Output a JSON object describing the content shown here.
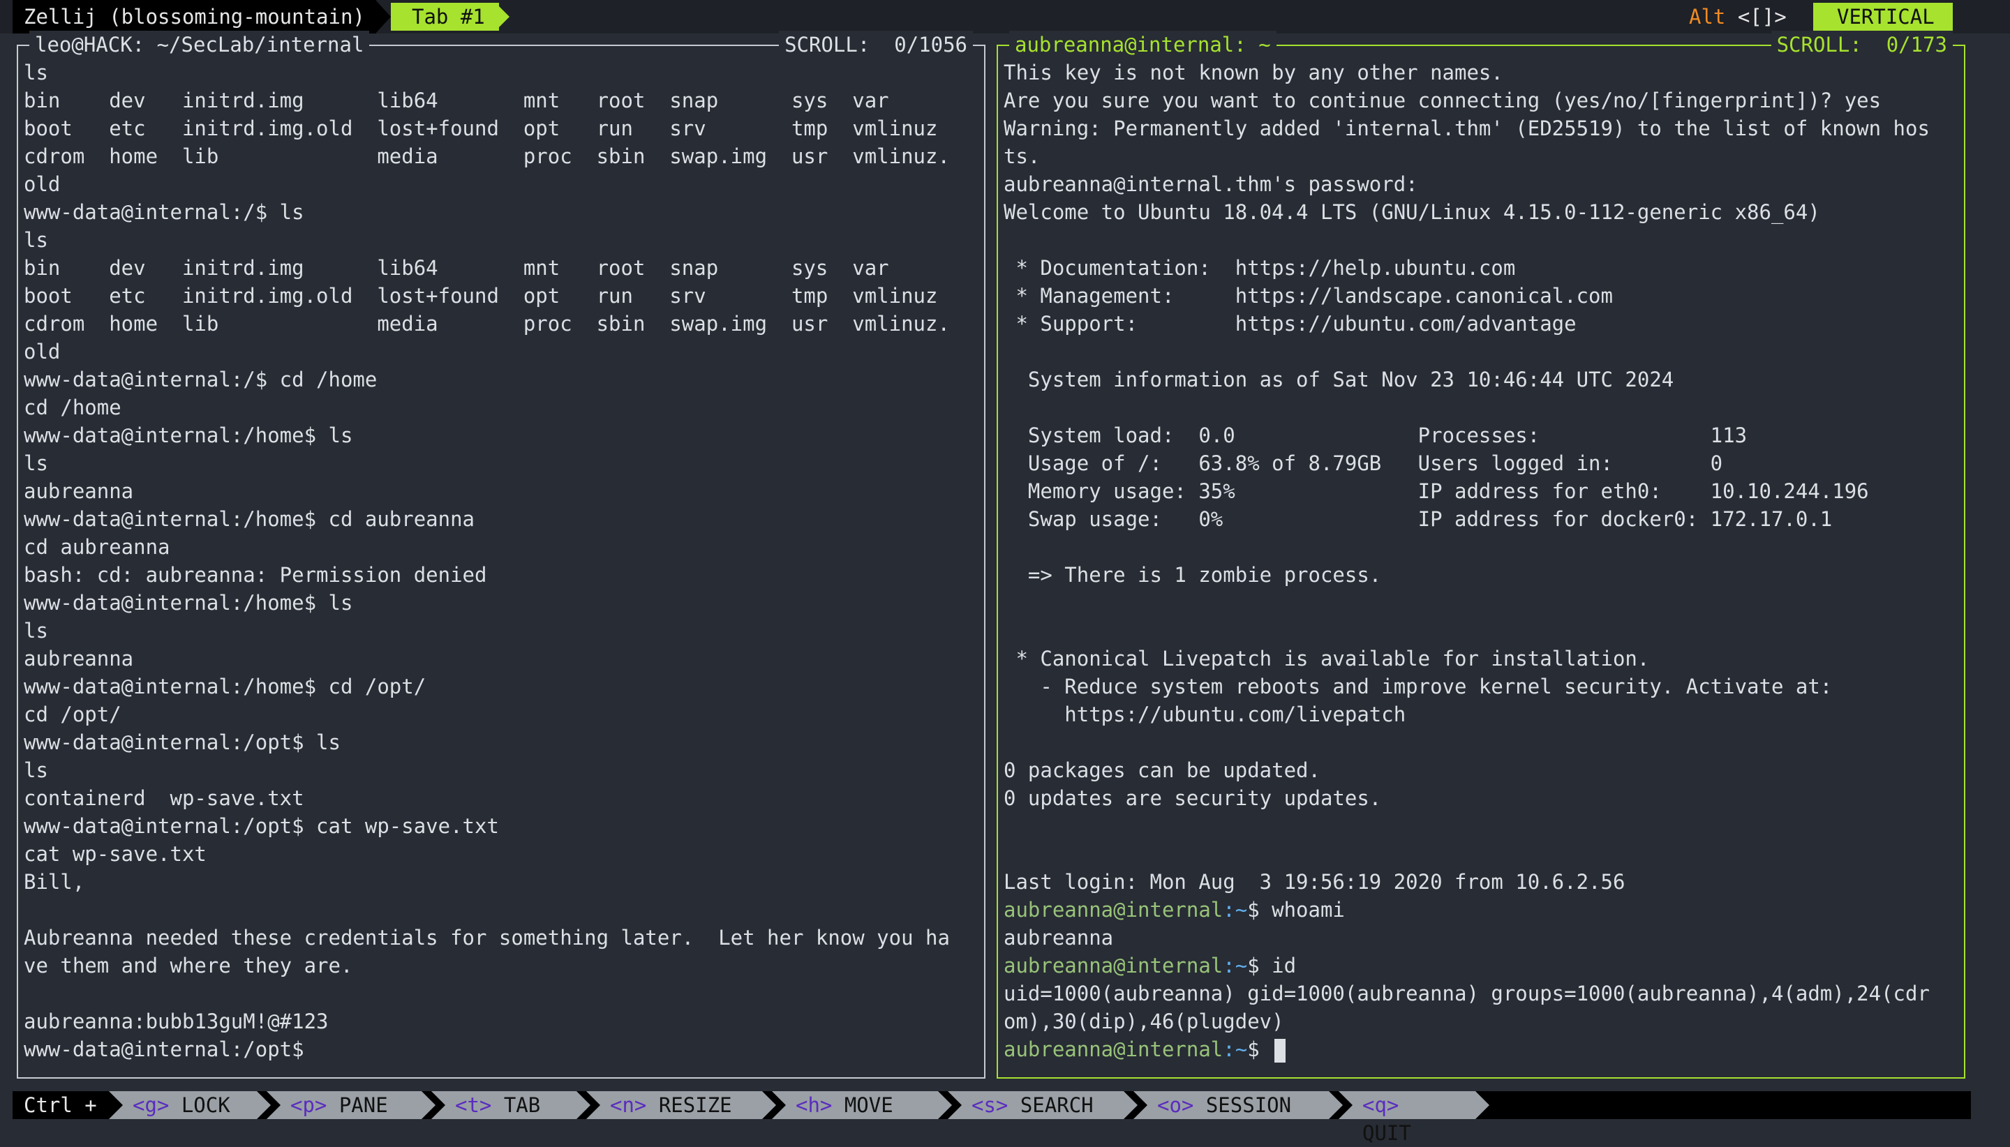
{
  "topbar": {
    "session": "Zellij (blossoming-mountain)",
    "tab": "Tab #1",
    "alt_label": "Alt",
    "alt_brackets": "<[]>",
    "mode": "VERTICAL"
  },
  "colors": {
    "accent": "#a6e22e",
    "prompt": "#98c379",
    "path": "#61afef",
    "alt": "#f08a24"
  },
  "pane_left": {
    "title": "leo@HACK: ~/SecLab/internal",
    "scroll": "SCROLL:  0/1056",
    "lines": [
      "ls",
      "bin    dev   initrd.img      lib64       mnt   root  snap      sys  var",
      "boot   etc   initrd.img.old  lost+found  opt   run   srv       tmp  vmlinuz",
      "cdrom  home  lib             media       proc  sbin  swap.img  usr  vmlinuz.",
      "old",
      "www-data@internal:/$ ls",
      "ls",
      "bin    dev   initrd.img      lib64       mnt   root  snap      sys  var",
      "boot   etc   initrd.img.old  lost+found  opt   run   srv       tmp  vmlinuz",
      "cdrom  home  lib             media       proc  sbin  swap.img  usr  vmlinuz.",
      "old",
      "www-data@internal:/$ cd /home",
      "cd /home",
      "www-data@internal:/home$ ls",
      "ls",
      "aubreanna",
      "www-data@internal:/home$ cd aubreanna",
      "cd aubreanna",
      "bash: cd: aubreanna: Permission denied",
      "www-data@internal:/home$ ls",
      "ls",
      "aubreanna",
      "www-data@internal:/home$ cd /opt/",
      "cd /opt/",
      "www-data@internal:/opt$ ls",
      "ls",
      "containerd  wp-save.txt",
      "www-data@internal:/opt$ cat wp-save.txt",
      "cat wp-save.txt",
      "Bill,",
      "",
      "Aubreanna needed these credentials for something later.  Let her know you ha",
      "ve them and where they are.",
      "",
      "aubreanna:bubb13guM!@#123",
      "www-data@internal:/opt$"
    ]
  },
  "pane_right": {
    "title": "aubreanna@internal: ~",
    "scroll": "SCROLL:  0/173",
    "lines": [
      "This key is not known by any other names.",
      "Are you sure you want to continue connecting (yes/no/[fingerprint])? yes",
      "Warning: Permanently added 'internal.thm' (ED25519) to the list of known hos",
      "ts.",
      "aubreanna@internal.thm's password:",
      "Welcome to Ubuntu 18.04.4 LTS (GNU/Linux 4.15.0-112-generic x86_64)",
      "",
      " * Documentation:  https://help.ubuntu.com",
      " * Management:     https://landscape.canonical.com",
      " * Support:        https://ubuntu.com/advantage",
      "",
      "  System information as of Sat Nov 23 10:46:44 UTC 2024",
      "",
      "  System load:  0.0               Processes:              113",
      "  Usage of /:   63.8% of 8.79GB   Users logged in:        0",
      "  Memory usage: 35%               IP address for eth0:    10.10.244.196",
      "  Swap usage:   0%                IP address for docker0: 172.17.0.1",
      "",
      "  => There is 1 zombie process.",
      "",
      "",
      " * Canonical Livepatch is available for installation.",
      "   - Reduce system reboots and improve kernel security. Activate at:",
      "     https://ubuntu.com/livepatch",
      "",
      "0 packages can be updated.",
      "0 updates are security updates.",
      "",
      "",
      "Last login: Mon Aug  3 19:56:19 2020 from 10.6.2.56"
    ],
    "prompt_user": "aubreanna@internal",
    "prompt_path": ":~",
    "prompt_symbol": "$ ",
    "session_end": [
      {
        "cmd": "whoami",
        "out": [
          "aubreanna"
        ]
      },
      {
        "cmd": "id",
        "out": [
          "uid=1000(aubreanna) gid=1000(aubreanna) groups=1000(aubreanna),4(adm),24(cdr",
          "om),30(dip),46(plugdev)"
        ]
      }
    ]
  },
  "statusbar": {
    "ctrl": "Ctrl +",
    "keys": [
      {
        "key": "<g>",
        "label": "LOCK"
      },
      {
        "key": "<p>",
        "label": "PANE"
      },
      {
        "key": "<t>",
        "label": "TAB"
      },
      {
        "key": "<n>",
        "label": "RESIZE"
      },
      {
        "key": "<h>",
        "label": "MOVE"
      },
      {
        "key": "<s>",
        "label": "SEARCH"
      },
      {
        "key": "<o>",
        "label": "SESSION"
      },
      {
        "key": "<q>",
        "label": "QUIT"
      }
    ]
  }
}
